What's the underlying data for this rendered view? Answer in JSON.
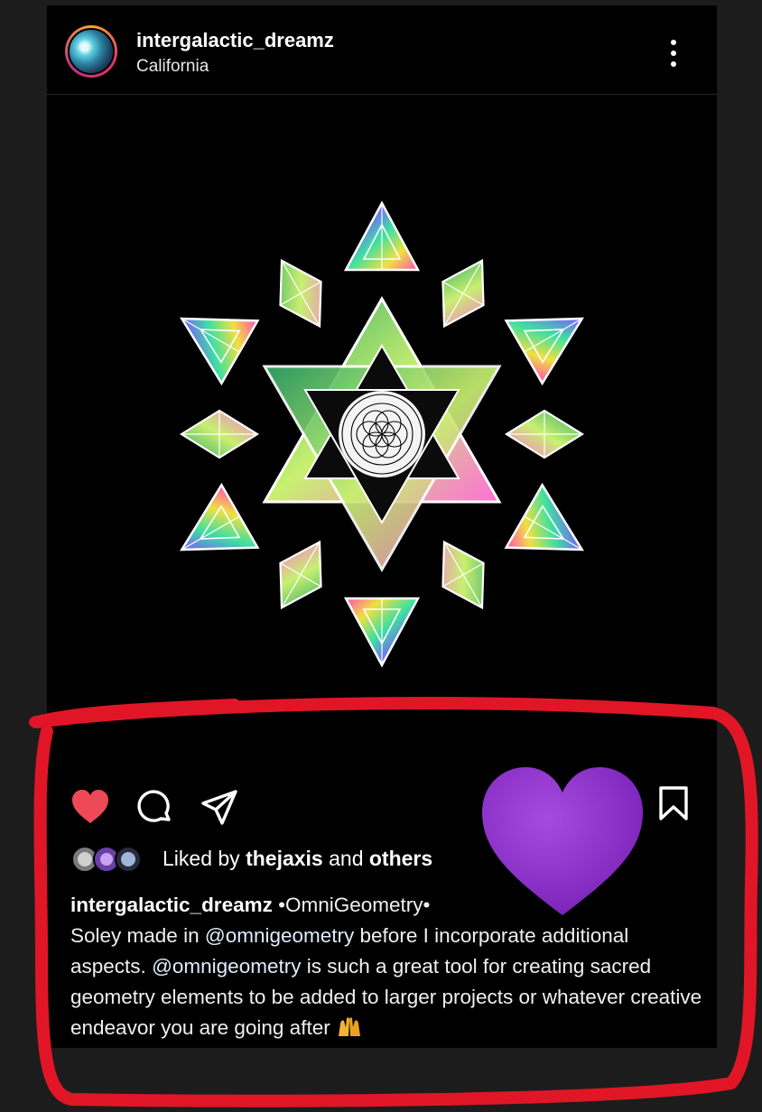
{
  "post": {
    "username": "intergalactic_dreamz",
    "location": "California",
    "liked_prefix": "Liked by",
    "liked_user": "thejaxis",
    "liked_and": "and",
    "liked_others": "others",
    "caption_user": "intergalactic_dreamz",
    "caption_tag": "•OmniGeometry•",
    "caption_p1": "Soley made in",
    "mention": "@omnigeometry",
    "caption_p2": "before I incorporate additional aspects.",
    "caption_p3": "is such a great tool for creating sacred geometry elements to be added to larger projects or whatever creative endeavor you are going after",
    "emoji": "raising-hands-emoji"
  },
  "colors": {
    "like_red": "#ed4956",
    "annotation_red": "#e01626",
    "overlay_heart": "#8a2bc4"
  },
  "icons": [
    "more-options-icon",
    "heart-icon",
    "comment-icon",
    "share-icon",
    "bookmark-icon"
  ]
}
